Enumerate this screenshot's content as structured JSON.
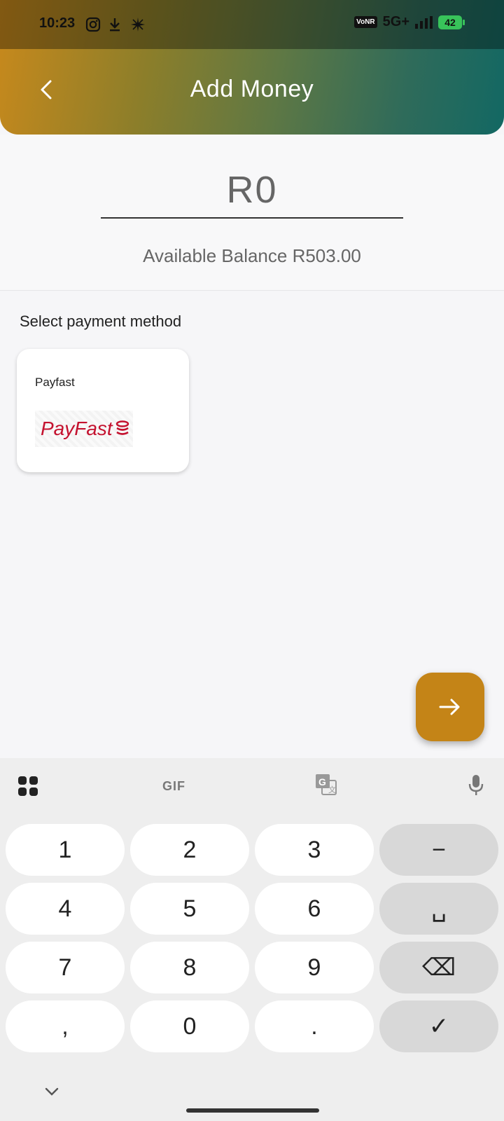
{
  "status_bar": {
    "time": "10:23",
    "network_badge": "VoNR",
    "network_type": "5G+",
    "battery": "42"
  },
  "header": {
    "title": "Add Money",
    "gradient_colors": [
      "#c8891c",
      "#126863"
    ]
  },
  "amount": {
    "value": "R0",
    "available_balance": "Available Balance R503.00"
  },
  "payment": {
    "section_label": "Select payment method",
    "methods": [
      {
        "name": "Payfast",
        "logo_text": "PayFast"
      }
    ]
  },
  "next_button": {
    "icon": "arrow-right-icon",
    "color": "#c48417"
  },
  "keyboard": {
    "toolbar": {
      "gif_label": "GIF"
    },
    "rows": [
      [
        "1",
        "2",
        "3",
        "−"
      ],
      [
        "4",
        "5",
        "6",
        "␣"
      ],
      [
        "7",
        "8",
        "9",
        "⌫"
      ],
      [
        ",",
        "0",
        ".",
        "✓"
      ]
    ]
  }
}
